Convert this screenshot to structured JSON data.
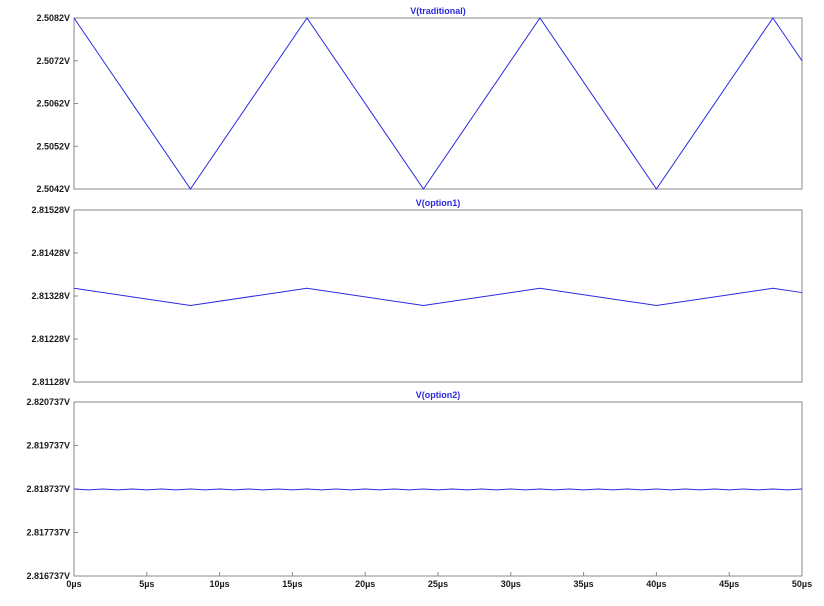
{
  "colors": {
    "trace": "#2a2ae0",
    "frame": "#8a8a8a",
    "text": "#1a1a1a"
  },
  "chart_data": [
    {
      "type": "line",
      "title": "V(traditional)",
      "x": [
        0,
        8,
        16,
        24,
        32,
        40,
        48,
        50
      ],
      "series": [
        {
          "name": "V(traditional)",
          "values": [
            2.5082,
            2.5042,
            2.5082,
            2.5042,
            2.5082,
            2.5042,
            2.5082,
            2.5072
          ]
        }
      ],
      "xlim": [
        0,
        50
      ],
      "ylim": [
        2.5042,
        2.5082
      ],
      "yticks": [
        2.5082,
        2.5072,
        2.5062,
        2.5052,
        2.5042
      ],
      "yticklabels": [
        "2.5082V",
        "2.5072V",
        "2.5062V",
        "2.5052V",
        "2.5042V"
      ],
      "grid": false
    },
    {
      "type": "line",
      "title": "V(option1)",
      "x": [
        0,
        8,
        16,
        24,
        32,
        40,
        48,
        50
      ],
      "series": [
        {
          "name": "V(option1)",
          "values": [
            2.81346,
            2.81306,
            2.81346,
            2.81306,
            2.81346,
            2.81306,
            2.81346,
            2.81336
          ]
        }
      ],
      "xlim": [
        0,
        50
      ],
      "ylim": [
        2.81128,
        2.81528
      ],
      "yticks": [
        2.81528,
        2.81428,
        2.81328,
        2.81228,
        2.81128
      ],
      "yticklabels": [
        "2.81528V",
        "2.81428V",
        "2.81328V",
        "2.81228V",
        "2.81128V"
      ],
      "grid": false
    },
    {
      "type": "line",
      "title": "V(option2)",
      "x": [
        0,
        1,
        2,
        3,
        4,
        5,
        6,
        7,
        8,
        9,
        10,
        11,
        12,
        13,
        14,
        15,
        16,
        17,
        18,
        19,
        20,
        21,
        22,
        23,
        24,
        25,
        26,
        27,
        28,
        29,
        30,
        31,
        32,
        33,
        34,
        35,
        36,
        37,
        38,
        39,
        40,
        41,
        42,
        43,
        44,
        45,
        46,
        47,
        48,
        49,
        50
      ],
      "series": [
        {
          "name": "V(option2)",
          "values": [
            2.818737,
            2.818717,
            2.818737,
            2.818717,
            2.818737,
            2.818717,
            2.818737,
            2.818717,
            2.818737,
            2.818717,
            2.818737,
            2.818717,
            2.818737,
            2.818717,
            2.818737,
            2.818717,
            2.818737,
            2.818717,
            2.818737,
            2.818717,
            2.818737,
            2.818717,
            2.818737,
            2.818717,
            2.818737,
            2.818717,
            2.818737,
            2.818717,
            2.818737,
            2.818717,
            2.818737,
            2.818717,
            2.818737,
            2.818717,
            2.818737,
            2.818717,
            2.818737,
            2.818717,
            2.818737,
            2.818717,
            2.818737,
            2.818717,
            2.818737,
            2.818717,
            2.818737,
            2.818717,
            2.818737,
            2.818717,
            2.818737,
            2.818717,
            2.818737
          ]
        }
      ],
      "xlim": [
        0,
        50
      ],
      "ylim": [
        2.816737,
        2.820737
      ],
      "yticks": [
        2.820737,
        2.819737,
        2.818737,
        2.817737,
        2.816737
      ],
      "yticklabels": [
        "2.820737V",
        "2.819737V",
        "2.818737V",
        "2.817737V",
        "2.816737V"
      ],
      "xticks": [
        0,
        5,
        10,
        15,
        20,
        25,
        30,
        35,
        40,
        45,
        50
      ],
      "xticklabels": [
        "0µs",
        "5µs",
        "10µs",
        "15µs",
        "20µs",
        "25µs",
        "30µs",
        "35µs",
        "40µs",
        "45µs",
        "50µs"
      ],
      "grid": false
    }
  ]
}
